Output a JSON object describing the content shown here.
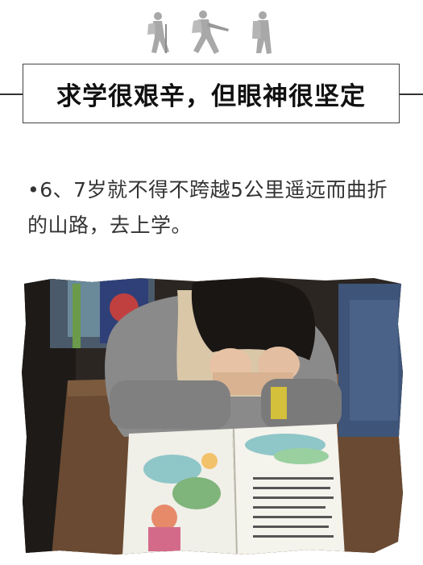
{
  "header": {
    "decoration_icon": "hikers-silhouette-icon",
    "title": "求学很艰辛，但眼神很坚定"
  },
  "body": {
    "bullet": "•",
    "text": "6、7岁就不得不跨越5公里遥远而曲折的山路，去上学。"
  },
  "photo": {
    "icon": "child-reading-photo"
  },
  "colors": {
    "title_text": "#111111",
    "body_text": "#333333",
    "hiker_gray": "#8f8f8f",
    "border": "#444444"
  }
}
